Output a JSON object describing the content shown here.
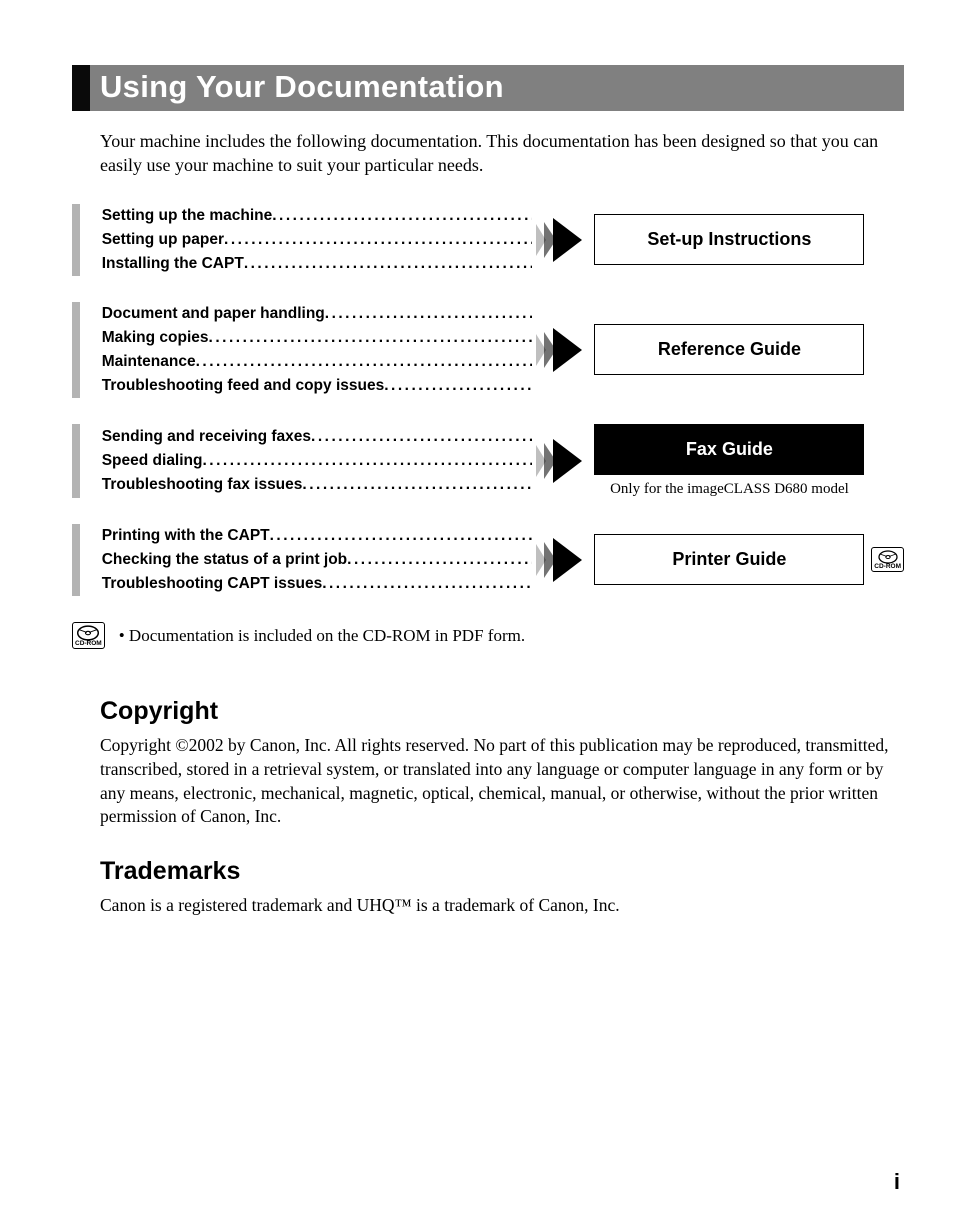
{
  "title": "Using Your Documentation",
  "intro": "Your machine includes the following documentation. This documentation has been designed so that you can easily use your machine to suit your particular needs.",
  "guides": [
    {
      "topics": [
        "Setting up the machine",
        "Setting up paper",
        "Installing the CAPT"
      ],
      "box": "Set-up Instructions",
      "dark": false,
      "note": "",
      "cdrom": false
    },
    {
      "topics": [
        "Document and paper handling",
        "Making copies",
        "Maintenance",
        "Troubleshooting feed and copy issues"
      ],
      "box": "Reference Guide",
      "dark": false,
      "note": "",
      "cdrom": false
    },
    {
      "topics": [
        "Sending and receiving faxes",
        "Speed dialing",
        "Troubleshooting fax issues"
      ],
      "box": "Fax Guide",
      "dark": true,
      "note": "Only for the imageCLASS D680 model",
      "cdrom": false
    },
    {
      "topics": [
        "Printing with the CAPT",
        "Checking the status of a print job",
        "Troubleshooting CAPT issues"
      ],
      "box": "Printer Guide",
      "dark": false,
      "note": "",
      "cdrom": true
    }
  ],
  "cdrom_label": "CD-ROM",
  "footnote": "•  Documentation is included on the CD-ROM in PDF form.",
  "copyright_heading": "Copyright",
  "copyright_body": "Copyright ©2002 by Canon, Inc. All rights reserved. No part of this publication may be reproduced, transmitted, transcribed, stored in a retrieval system, or translated into any language or computer language in any form or by any means, electronic, mechanical, magnetic, optical, chemical, manual, or otherwise, without the prior written permission of Canon, Inc.",
  "trademarks_heading": "Trademarks",
  "trademarks_body": "Canon is a registered trademark and UHQ™ is a trademark of Canon, Inc.",
  "page_number": "i"
}
